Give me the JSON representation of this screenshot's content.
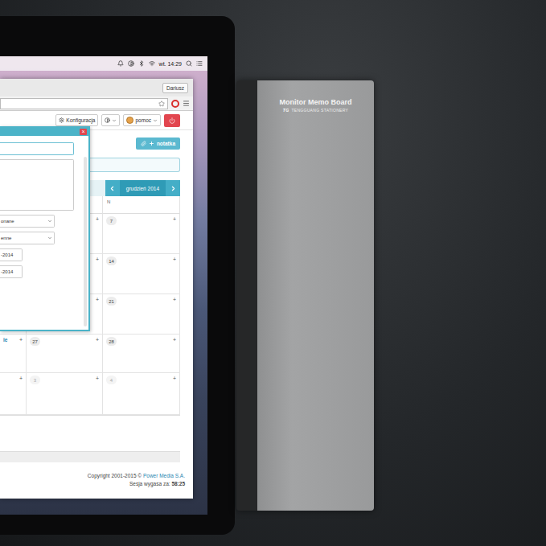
{
  "menubar": {
    "clock": "wt. 14:29"
  },
  "browser": {
    "profile": "Dariusz"
  },
  "app": {
    "settings": "Konfiguracja",
    "help": "pomoc",
    "add_note": "notatka"
  },
  "dialog": {
    "close": "×",
    "fields": [
      {
        "kind": "text",
        "value": ""
      },
      {
        "kind": "textarea",
        "value": ""
      },
      {
        "kind": "select",
        "value": "onane"
      },
      {
        "kind": "select",
        "value": "enne"
      },
      {
        "kind": "date",
        "value": "-2014"
      },
      {
        "kind": "date",
        "value": "-2014"
      }
    ]
  },
  "calendar": {
    "month": "grudzień 2014",
    "add": "+",
    "columns": [
      "",
      "",
      "N"
    ],
    "rows": [
      [
        {
          "day": "",
          "note": "",
          "other_month": false
        },
        {
          "day": "",
          "note": "",
          "other_month": false
        },
        {
          "day": "7",
          "note": "",
          "other_month": false
        }
      ],
      [
        {
          "day": "",
          "note": "",
          "other_month": false
        },
        {
          "day": "",
          "note": "",
          "other_month": false
        },
        {
          "day": "14",
          "note": "",
          "other_month": false
        }
      ],
      [
        {
          "day": "",
          "note": "",
          "other_month": false
        },
        {
          "day": "",
          "note": "",
          "other_month": false
        },
        {
          "day": "21",
          "note": "",
          "other_month": false
        }
      ],
      [
        {
          "day": "",
          "note": "ie",
          "other_month": false
        },
        {
          "day": "27",
          "note": "",
          "other_month": false
        },
        {
          "day": "28",
          "note": "",
          "other_month": false
        }
      ],
      [
        {
          "day": "",
          "note": "",
          "other_month": true
        },
        {
          "day": "3",
          "note": "",
          "other_month": true
        },
        {
          "day": "4",
          "note": "",
          "other_month": true
        }
      ]
    ]
  },
  "footer": {
    "copyright": "Copyright 2001-2015 ©",
    "company": "Power Media S.A.",
    "session_label": "Sesja wygasa za:",
    "session_time": "58:25"
  },
  "memo_board": {
    "title": "Monitor Memo Board",
    "logo": "TG",
    "brand": "TENGGUANG STATIONERY"
  }
}
